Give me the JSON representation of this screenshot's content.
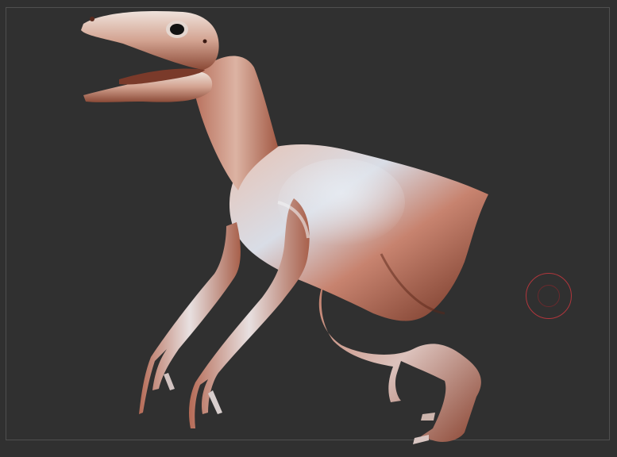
{
  "viewport": {
    "background_color": "#303030",
    "frame_color": "#4f4f4f"
  },
  "model": {
    "subject": "raptor-sculpt",
    "material_colors": {
      "highlight": "#dfe6ee",
      "mid": "#c98f80",
      "shadow": "#7a3a2a",
      "deep": "#4a1e14"
    }
  },
  "brush_cursor": {
    "outer_color": "#b0363c",
    "inner_color": "#6a2a2d"
  }
}
